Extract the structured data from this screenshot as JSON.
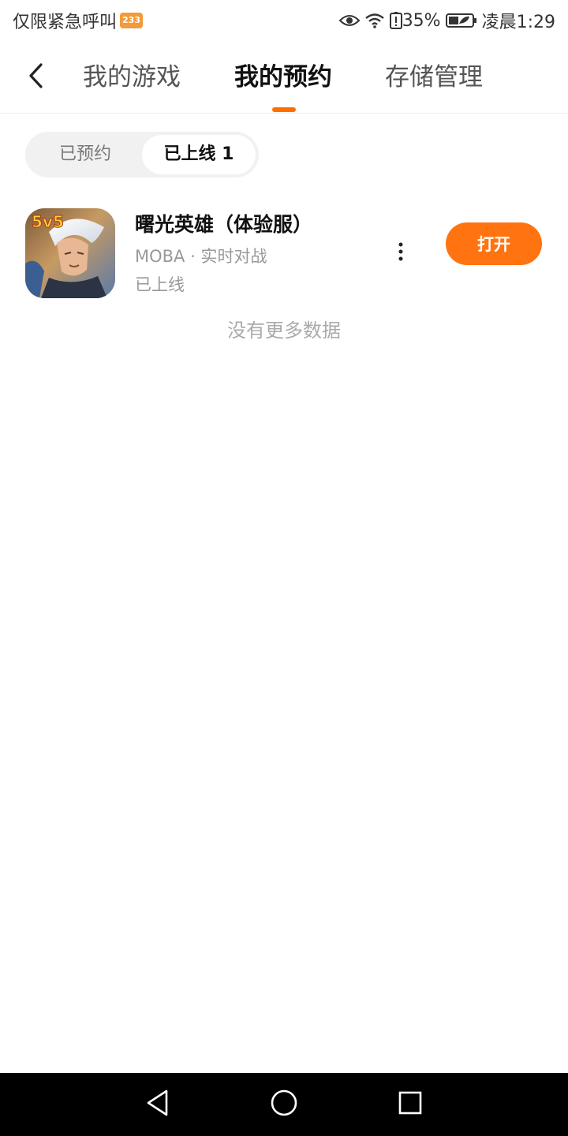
{
  "status_bar": {
    "left_text": "仅限紧急呼叫",
    "badge": "233",
    "battery": "35%",
    "time": "凌晨1:29"
  },
  "header": {
    "tabs": [
      {
        "label": "我的游戏",
        "active": false
      },
      {
        "label": "我的预约",
        "active": true
      },
      {
        "label": "存储管理",
        "active": false
      }
    ]
  },
  "segment": {
    "items": [
      {
        "label": "已预约",
        "active": false
      },
      {
        "label": "已上线 1",
        "active": true
      }
    ]
  },
  "game": {
    "icon_badge": "5v5",
    "title": "曙光英雄（体验服）",
    "subtitle": "MOBA · 实时对战",
    "status": "已上线",
    "action_label": "打开"
  },
  "footer_message": "没有更多数据",
  "colors": {
    "accent": "#ff7410",
    "underline": "#ff6f00"
  },
  "icons": {
    "back": "chevron-left-icon",
    "more": "more-vertical-icon",
    "nav_back": "triangle-back-icon",
    "nav_home": "circle-home-icon",
    "nav_recent": "square-recent-icon"
  }
}
